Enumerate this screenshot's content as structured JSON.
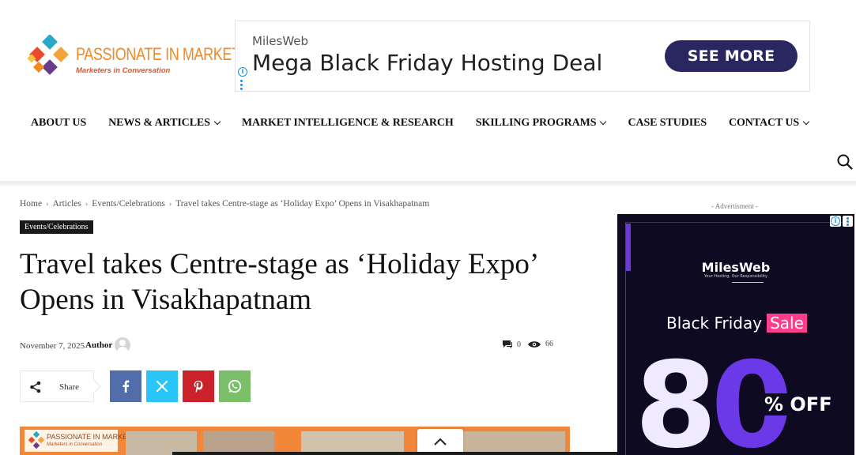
{
  "site": {
    "logo_text": "PASSIONATE IN MARKETING",
    "logo_tagline": "Marketers in Conversation"
  },
  "top_ad": {
    "brand": "MilesWeb",
    "headline": "Mega Black Friday Hosting Deal",
    "cta": "SEE MORE"
  },
  "nav": {
    "items": [
      {
        "label": "ABOUT US"
      },
      {
        "label": "NEWS & ARTICLES"
      },
      {
        "label": "MARKET INTELLIGENCE & RESEARCH"
      },
      {
        "label": "SKILLING PROGRAMS"
      },
      {
        "label": "CASE STUDIES"
      },
      {
        "label": "CONTACT US"
      }
    ]
  },
  "breadcrumb": {
    "items": [
      "Home",
      "Articles",
      "Events/Celebrations",
      "Travel takes Centre-stage as ‘Holiday Expo’ Opens in Visakhapatnam"
    ]
  },
  "article": {
    "category": "Events/Celebrations",
    "title": "Travel takes Centre-stage as ‘Holiday Expo’ Opens in Visakhapatnam",
    "date": "November 7, 2025",
    "author": "Author",
    "comments": "0",
    "views": "66"
  },
  "share": {
    "label": "Share"
  },
  "sidebar_ad": {
    "label": "- Advertisment -",
    "brand": "MilesWeb",
    "tagline": "Your Hosting, Our Responsibility",
    "headline": "Black Friday",
    "sale": "Sale",
    "big_digit_1": "8",
    "big_digit_2": "0",
    "off": "% OFF"
  },
  "colors": {
    "logo_orange": "#f08a24",
    "cta_navy": "#2a2760",
    "facebook": "#516eab",
    "twitter": "#29c5f6",
    "pinterest": "#ca212a",
    "whatsapp": "#7bbf6a",
    "sale_pink": "#ff3d8b"
  }
}
